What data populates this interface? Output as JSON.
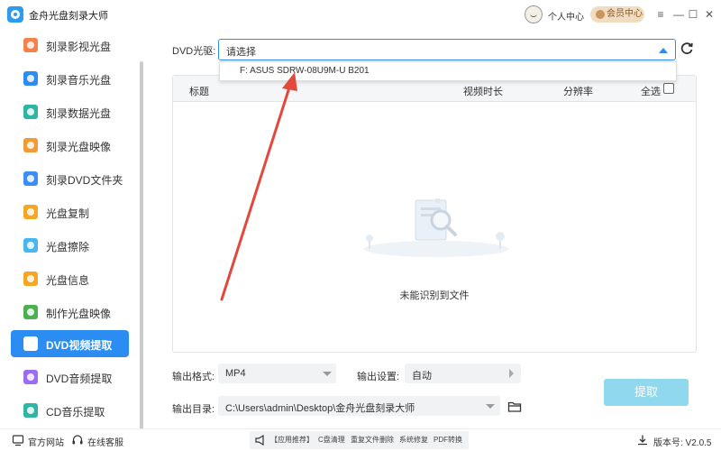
{
  "app": {
    "title": "金舟光盘刻录大师",
    "user_center": "个人中心",
    "vip_label": "会员中心",
    "window_controls": [
      "≡",
      "—",
      "☐",
      "✕"
    ]
  },
  "sidebar": {
    "items": [
      {
        "label": "刻录影视光盘",
        "icon": "film-disc-icon",
        "color": "#f4834a"
      },
      {
        "label": "刻录音乐光盘",
        "icon": "music-disc-icon",
        "color": "#2b8df2"
      },
      {
        "label": "刻录数据光盘",
        "icon": "data-disc-icon",
        "color": "#2fb5a5"
      },
      {
        "label": "刻录光盘映像",
        "icon": "image-disc-icon",
        "color": "#f29a33"
      },
      {
        "label": "刻录DVD文件夹",
        "icon": "dvd-folder-icon",
        "color": "#3d8ef2"
      },
      {
        "label": "光盘复制",
        "icon": "copy-disc-icon",
        "color": "#f5a623"
      },
      {
        "label": "光盘擦除",
        "icon": "erase-disc-icon",
        "color": "#49b6f0"
      },
      {
        "label": "光盘信息",
        "icon": "info-disc-icon",
        "color": "#f5a623"
      },
      {
        "label": "制作光盘映像",
        "icon": "make-image-icon",
        "color": "#4caf50"
      },
      {
        "label": "DVD视频提取",
        "icon": "dvd-video-icon",
        "color": "#ffffff",
        "active": true
      },
      {
        "label": "DVD音频提取",
        "icon": "dvd-audio-icon",
        "color": "#9c6cf2"
      },
      {
        "label": "CD音乐提取",
        "icon": "cd-music-icon",
        "color": "#2fb5a5"
      }
    ]
  },
  "drive": {
    "label": "DVD光驱:",
    "placeholder": "请选择",
    "options": [
      "F: ASUS SDRW-08U9M-U B201"
    ]
  },
  "table": {
    "columns": [
      "标题",
      "视频时长",
      "分辨率",
      "全选"
    ],
    "empty_text": "未能识别到文件"
  },
  "output": {
    "format_label": "输出格式:",
    "format_value": "MP4",
    "settings_label": "输出设置:",
    "settings_value": "自动",
    "dir_label": "输出目录:",
    "dir_value": "C:\\Users\\admin\\Desktop\\金舟光盘刻录大师",
    "extract_button": "提取"
  },
  "statusbar": {
    "official_site": "官方网站",
    "online_service": "在线客服",
    "tools": [
      "【应用推荐】",
      "C盘清理",
      "重复文件删除",
      "系统修复",
      "PDF转换"
    ],
    "version": "版本号: V2.0.5"
  },
  "colors": {
    "accent": "#2b8df2",
    "extract_button": "#8fd8ee",
    "annotation_arrow": "#e2483b"
  }
}
